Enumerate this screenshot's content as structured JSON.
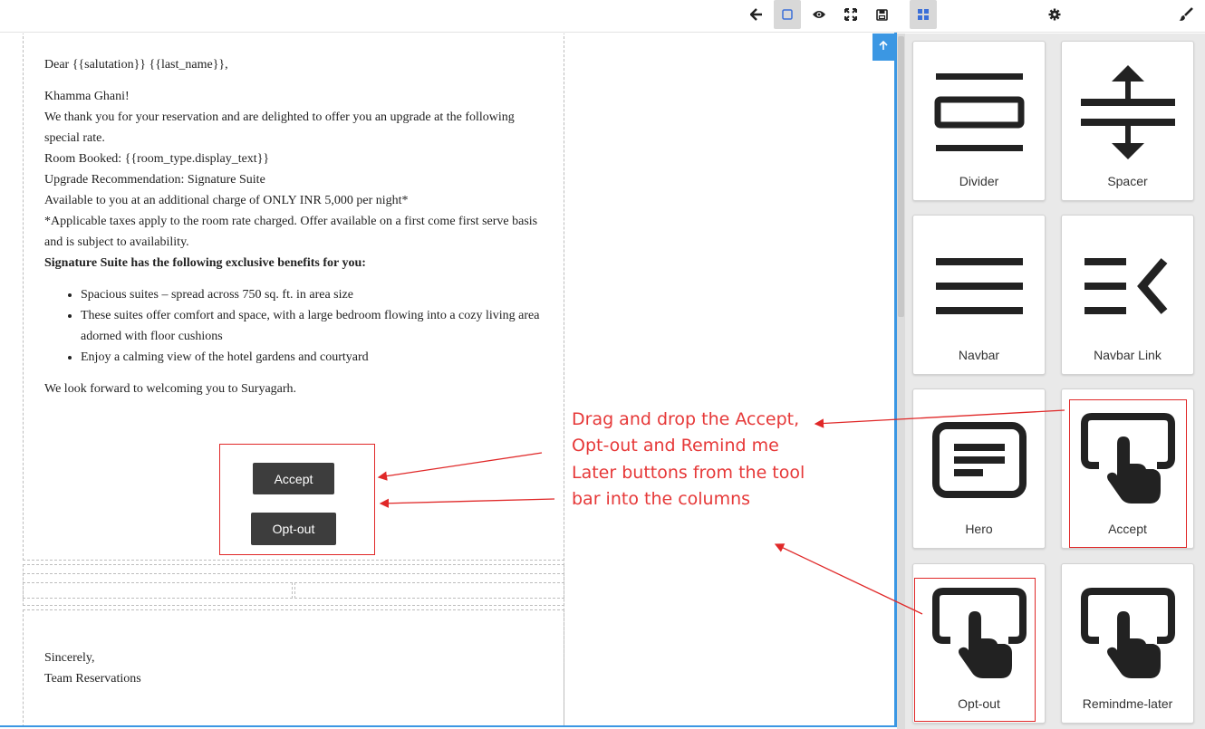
{
  "toolbar": {
    "icons": [
      "back-arrow-icon",
      "square-outline-icon",
      "eye-icon",
      "fullscreen-icon",
      "save-icon",
      "blocks-grid-icon",
      "gear-icon",
      "brush-icon"
    ],
    "accent": "#3b97e3"
  },
  "email": {
    "greeting": "Dear {{salutation}} {{last_name}},",
    "lines": [
      "Khamma Ghani!",
      "We thank you for your reservation and are delighted to offer you an upgrade at the following special rate.",
      "Room Booked: {{room_type.display_text}}",
      "Upgrade Recommendation: Signature Suite",
      "Available to you at an additional charge of ONLY INR 5,000 per night*",
      "*Applicable taxes apply to the room rate charged. Offer available on a first come first serve basis and is subject to availability."
    ],
    "benefits_heading": "Signature Suite has the following exclusive benefits for you:",
    "benefits": [
      "Spacious suites – spread across 750 sq. ft. in area size",
      "These suites offer comfort and space, with a large bedroom flowing into a cozy living area adorned with floor cushions",
      "Enjoy a calming view of the hotel gardens and courtyard"
    ],
    "closing": "We look forward to welcoming you to Suryagarh.",
    "buttons": {
      "accept": "Accept",
      "optout": "Opt-out"
    },
    "signoff": "Sincerely,",
    "signature": "Team Reservations"
  },
  "annotation": {
    "text": "Drag and drop the Accept, Opt-out and Remind me Later buttons from the tool bar into the columns",
    "color": "#e63838"
  },
  "blocks": [
    {
      "label": "Divider",
      "icon": "divider-icon"
    },
    {
      "label": "Spacer",
      "icon": "spacer-icon"
    },
    {
      "label": "Navbar",
      "icon": "navbar-icon"
    },
    {
      "label": "Navbar Link",
      "icon": "navbar-link-icon"
    },
    {
      "label": "Hero",
      "icon": "hero-icon"
    },
    {
      "label": "Accept",
      "icon": "tap-icon"
    },
    {
      "label": "Opt-out",
      "icon": "tap-icon"
    },
    {
      "label": "Remindme-later",
      "icon": "tap-icon"
    }
  ]
}
